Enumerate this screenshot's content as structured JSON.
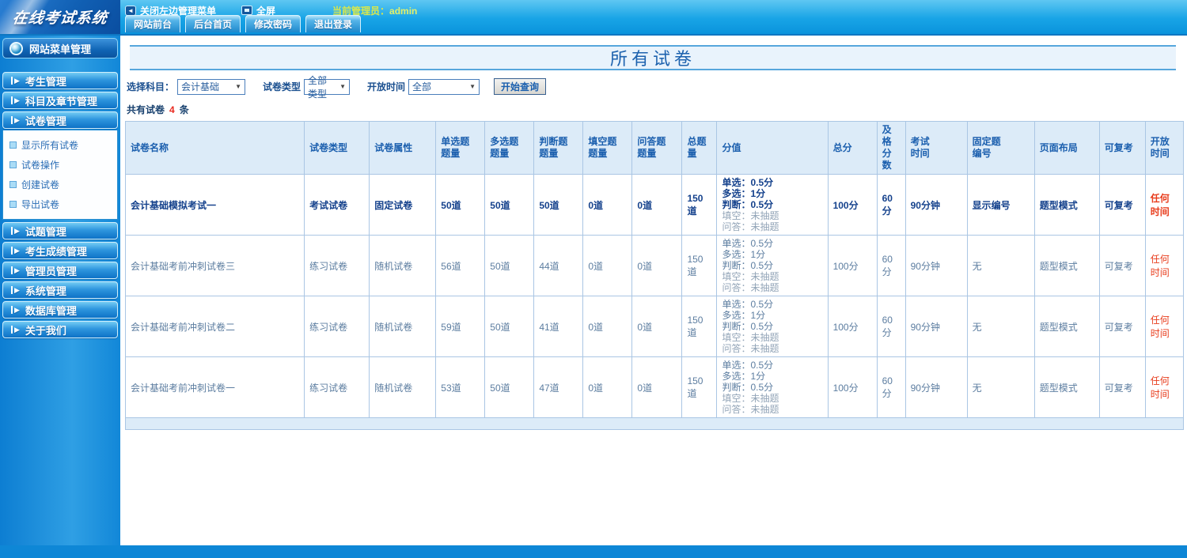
{
  "colors": {
    "accent": "#1d62ae",
    "red": "#e83c1c",
    "muted": "#93a5b8",
    "admin_text": "#d9e84c",
    "table_header_bg": "#dcebf8"
  },
  "header": {
    "logo": "在线考试系统",
    "close_menu_label": "关闭左边管理菜单",
    "collapse_icon_glyph": "◄",
    "fullscreen_label": "全屏",
    "admin_label": "当前管理员：",
    "admin_name": "admin",
    "tabs": [
      {
        "id": "site-front",
        "label": "网站前台"
      },
      {
        "id": "admin-home",
        "label": "后台首页"
      },
      {
        "id": "change-password",
        "label": "修改密码"
      },
      {
        "id": "logout",
        "label": "退出登录"
      }
    ]
  },
  "sidebar": {
    "title": "网站菜单管理",
    "sections": [
      {
        "id": "examinee-management",
        "label": "考生管理"
      },
      {
        "id": "subject-chapter-management",
        "label": "科目及章节管理"
      },
      {
        "id": "paper-management",
        "label": "试卷管理",
        "items": [
          {
            "id": "show-all-papers",
            "label": "显示所有试卷"
          },
          {
            "id": "paper-operations",
            "label": "试卷操作"
          },
          {
            "id": "create-paper",
            "label": "创建试卷"
          },
          {
            "id": "export-paper",
            "label": "导出试卷"
          }
        ]
      },
      {
        "id": "question-management",
        "label": "试题管理"
      },
      {
        "id": "score-management",
        "label": "考生成绩管理"
      },
      {
        "id": "admin-management",
        "label": "管理员管理"
      },
      {
        "id": "system-management",
        "label": "系统管理"
      },
      {
        "id": "database-management",
        "label": "数据库管理"
      },
      {
        "id": "about-us",
        "label": "关于我们"
      }
    ]
  },
  "main": {
    "title": "所有试卷",
    "filters": {
      "subject_label": "选择科目：",
      "subject_value": "会计基础",
      "type_label": "试卷类型",
      "type_value": "全部类型",
      "time_label": "开放时间",
      "time_value": "全部",
      "query_button": "开始查询"
    },
    "count": {
      "prefix": "共有试卷",
      "number": "4",
      "suffix": "条"
    },
    "table": {
      "headers": [
        "试卷名称",
        "试卷类型",
        "试卷属性",
        "单选题\n题量",
        "多选题\n题量",
        "判断题\n题量",
        "填空题\n题量",
        "问答题\n题量",
        "总题量",
        "分值",
        "总分",
        "及格\n分数",
        "考试\n时间",
        "固定题\n编号",
        "页面布局",
        "可复考",
        "开放时间"
      ],
      "rows": [
        {
          "name": "会计基础模拟考试一",
          "type": "考试试卷",
          "attr": "固定试卷",
          "single": "50道",
          "multi": "50道",
          "judge": "50道",
          "fill": "0道",
          "qa": "0道",
          "total": "150道",
          "scores": [
            {
              "text": "单选：0.5分"
            },
            {
              "text": "多选：1分"
            },
            {
              "text": "判断：0.5分"
            },
            {
              "text": "填空：未抽题",
              "muted": true
            },
            {
              "text": "问答：未抽题",
              "muted": true
            }
          ],
          "total_score": "100分",
          "pass_score": "60分",
          "duration": "90分钟",
          "fixed_no": "显示编号",
          "layout": "题型模式",
          "retake": "可复考",
          "open_time": "任何时间",
          "bold": true
        },
        {
          "name": "会计基础考前冲刺试卷三",
          "type": "练习试卷",
          "attr": "随机试卷",
          "single": "56道",
          "multi": "50道",
          "judge": "44道",
          "fill": "0道",
          "qa": "0道",
          "total": "150道",
          "scores": [
            {
              "text": "单选：0.5分"
            },
            {
              "text": "多选：1分"
            },
            {
              "text": "判断：0.5分"
            },
            {
              "text": "填空：未抽题",
              "muted": true
            },
            {
              "text": "问答：未抽题",
              "muted": true
            }
          ],
          "total_score": "100分",
          "pass_score": "60分",
          "duration": "90分钟",
          "fixed_no": "无",
          "layout": "题型模式",
          "retake": "可复考",
          "open_time": "任何时间",
          "bold": false
        },
        {
          "name": "会计基础考前冲刺试卷二",
          "type": "练习试卷",
          "attr": "随机试卷",
          "single": "59道",
          "multi": "50道",
          "judge": "41道",
          "fill": "0道",
          "qa": "0道",
          "total": "150道",
          "scores": [
            {
              "text": "单选：0.5分"
            },
            {
              "text": "多选：1分"
            },
            {
              "text": "判断：0.5分"
            },
            {
              "text": "填空：未抽题",
              "muted": true
            },
            {
              "text": "问答：未抽题",
              "muted": true
            }
          ],
          "total_score": "100分",
          "pass_score": "60分",
          "duration": "90分钟",
          "fixed_no": "无",
          "layout": "题型模式",
          "retake": "可复考",
          "open_time": "任何时间",
          "bold": false
        },
        {
          "name": "会计基础考前冲刺试卷一",
          "type": "练习试卷",
          "attr": "随机试卷",
          "single": "53道",
          "multi": "50道",
          "judge": "47道",
          "fill": "0道",
          "qa": "0道",
          "total": "150道",
          "scores": [
            {
              "text": "单选：0.5分"
            },
            {
              "text": "多选：1分"
            },
            {
              "text": "判断：0.5分"
            },
            {
              "text": "填空：未抽题",
              "muted": true
            },
            {
              "text": "问答：未抽题",
              "muted": true
            }
          ],
          "total_score": "100分",
          "pass_score": "60分",
          "duration": "90分钟",
          "fixed_no": "无",
          "layout": "题型模式",
          "retake": "可复考",
          "open_time": "任何时间",
          "bold": false
        }
      ]
    }
  }
}
